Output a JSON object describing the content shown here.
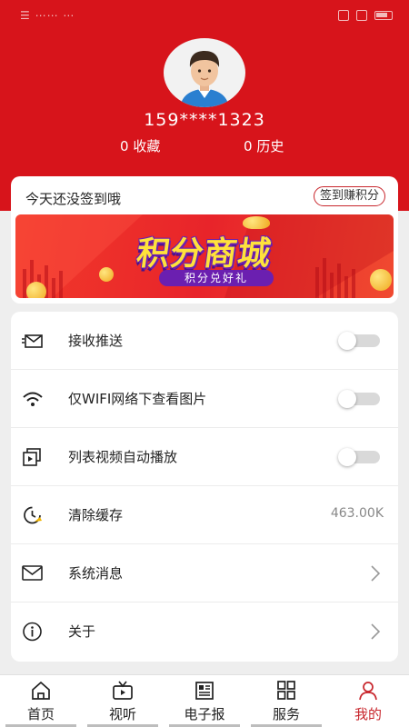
{
  "status_bar": {
    "left_text": "☰ ⋯⋯ ⋯"
  },
  "profile": {
    "phone": "159****1323",
    "collect_count": "0",
    "collect_label": "收藏",
    "history_count": "0",
    "history_label": "历史"
  },
  "checkin": {
    "prompt": "今天还没签到哦",
    "button_label": "签到赚积分"
  },
  "banner": {
    "title": "积分商城",
    "subtitle": "积分兑好礼"
  },
  "settings": [
    {
      "label": "接收推送",
      "icon": "mail-push-icon",
      "type": "toggle",
      "enabled": false
    },
    {
      "label": "仅WIFI网络下查看图片",
      "icon": "wifi-icon",
      "type": "toggle",
      "enabled": false
    },
    {
      "label": "列表视频自动播放",
      "icon": "video-play-icon",
      "type": "toggle",
      "enabled": false
    },
    {
      "label": "清除缓存",
      "icon": "clock-clean-icon",
      "type": "value",
      "value": "463.00K"
    },
    {
      "label": "系统消息",
      "icon": "envelope-icon",
      "type": "link"
    },
    {
      "label": "关于",
      "icon": "info-icon",
      "type": "link"
    }
  ],
  "tabbar": [
    {
      "label": "首页",
      "icon": "home-icon",
      "active": false
    },
    {
      "label": "视听",
      "icon": "tv-icon",
      "active": false
    },
    {
      "label": "电子报",
      "icon": "newspaper-icon",
      "active": false
    },
    {
      "label": "服务",
      "icon": "grid-icon",
      "active": false
    },
    {
      "label": "我的",
      "icon": "user-icon",
      "active": true
    }
  ],
  "colors": {
    "brand_red": "#d7141b",
    "active_tab": "#c8262c",
    "toggle_off": "#d9d9d9"
  }
}
